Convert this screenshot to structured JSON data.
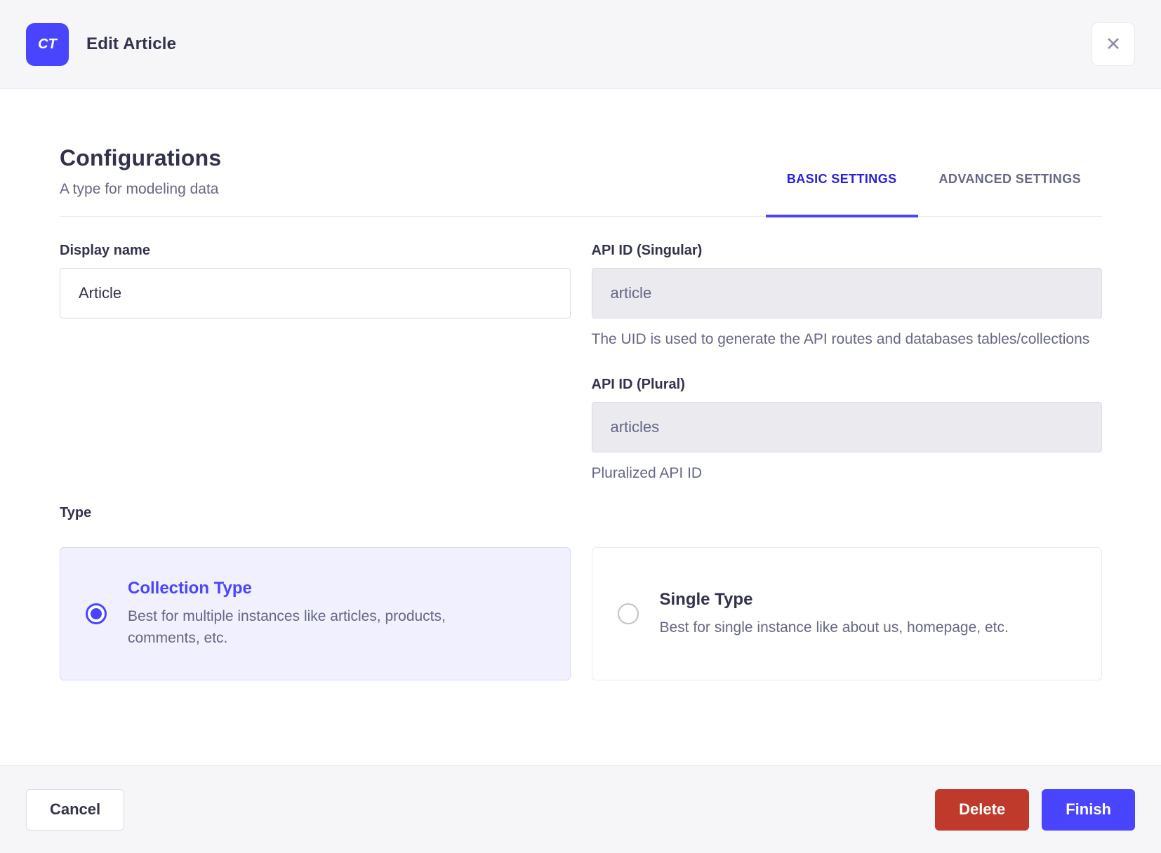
{
  "header": {
    "badge": "CT",
    "title": "Edit Article",
    "close_icon": "✕"
  },
  "intro": {
    "title": "Configurations",
    "subtitle": "A type for modeling data"
  },
  "tabs": [
    {
      "label": "BASIC SETTINGS",
      "active": true
    },
    {
      "label": "ADVANCED SETTINGS",
      "active": false
    }
  ],
  "form": {
    "display_name": {
      "label": "Display name",
      "value": "Article"
    },
    "api_id_singular": {
      "label": "API ID (Singular)",
      "value": "article",
      "hint": "The UID is used to generate the API routes and databases tables/collections",
      "disabled": true
    },
    "api_id_plural": {
      "label": "API ID (Plural)",
      "value": "articles",
      "hint": "Pluralized API ID",
      "disabled": true
    },
    "type": {
      "label": "Type",
      "options": [
        {
          "title": "Collection Type",
          "description": "Best for multiple instances like articles, products, comments, etc.",
          "selected": true
        },
        {
          "title": "Single Type",
          "description": "Best for single instance like about us, homepage, etc.",
          "selected": false
        }
      ]
    }
  },
  "footer": {
    "cancel": "Cancel",
    "delete": "Delete",
    "finish": "Finish"
  },
  "colors": {
    "primary": "#4945ff",
    "primary_dark": "#271fe0",
    "danger": "#bf3a2b",
    "text_dark": "#32324d",
    "text_gray": "#666687",
    "selected_card_bg": "#f0f0ff"
  }
}
